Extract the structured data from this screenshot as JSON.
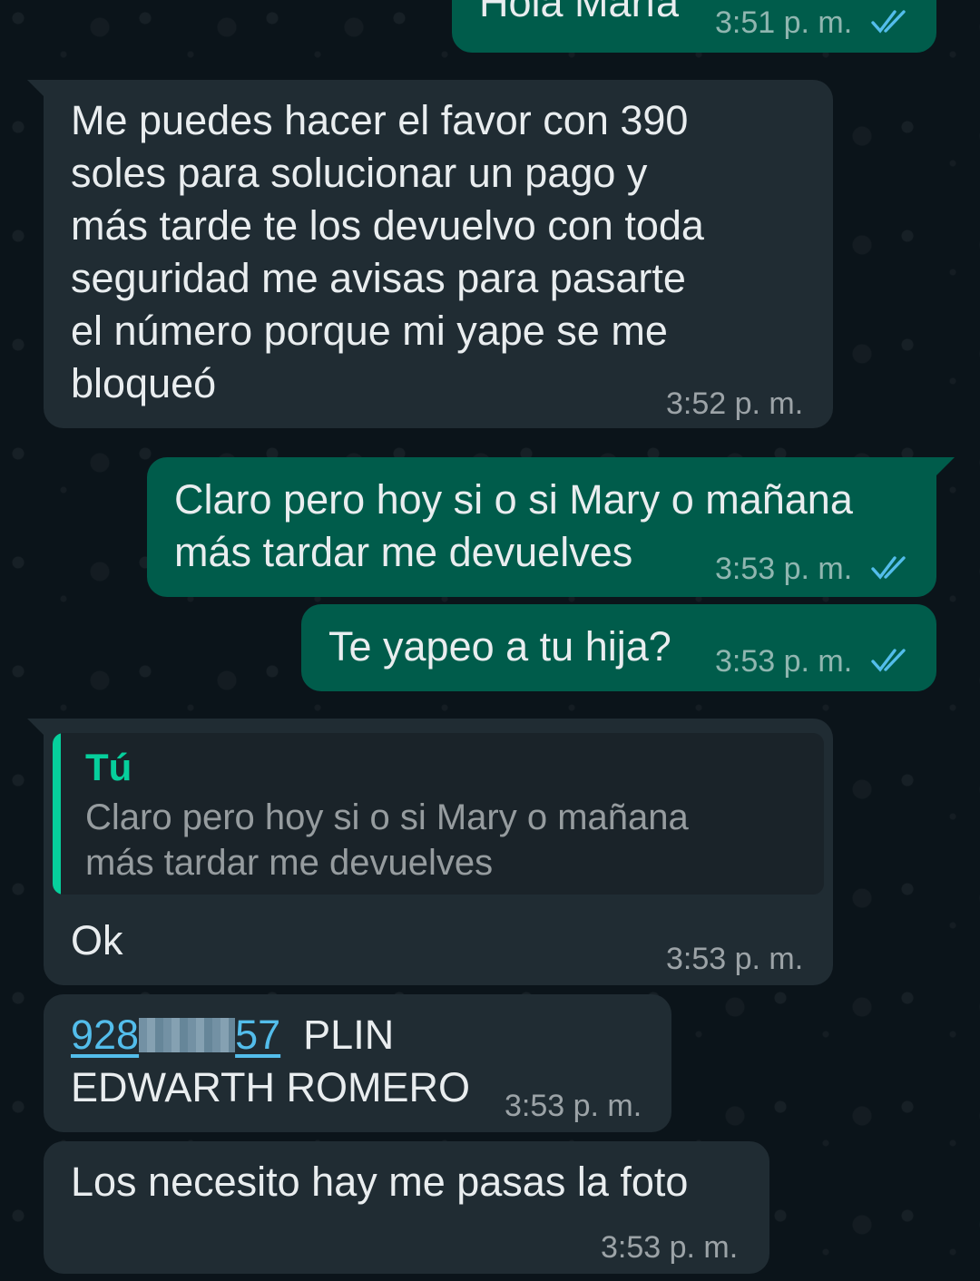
{
  "messages": {
    "m1": {
      "text": "Hola María",
      "time": "3:51 p. m."
    },
    "m2": {
      "lines": [
        "Me puedes hacer el favor con 390",
        "soles para solucionar un pago y",
        "más tarde te los devuelvo con toda",
        "seguridad me avisas para pasarte",
        "el número porque mi yape se me",
        "bloqueó"
      ],
      "time": "3:52 p. m."
    },
    "m3": {
      "lines": [
        "Claro pero hoy si o si Mary o mañana",
        "más tardar me devuelves"
      ],
      "time": "3:53 p. m."
    },
    "m4": {
      "text": "Te yapeo a tu hija?",
      "time": "3:53 p. m."
    },
    "m5": {
      "quote": {
        "author": "Tú",
        "lines": [
          "Claro pero hoy si o si Mary o mañana",
          "más tardar me devuelves"
        ]
      },
      "text": "Ok",
      "time": "3:53 p. m."
    },
    "m6": {
      "phone_start": "928",
      "phone_end": "57",
      "label": "PLIN",
      "name": "EDWARTH ROMERO",
      "time": "3:53 p. m."
    },
    "m7": {
      "text": "Los necesito hay me pasas la foto",
      "time": "3:53 p. m."
    }
  },
  "colors": {
    "background": "#0b141a",
    "incoming_bubble": "#202c33",
    "outgoing_bubble": "#005c4b",
    "read_ticks": "#53bdeb",
    "quote_accent": "#06cf9c"
  }
}
